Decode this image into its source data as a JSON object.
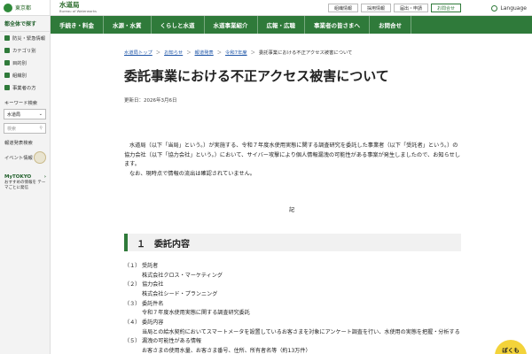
{
  "sidebar": {
    "logo_text": "東京都",
    "section_title": "都全体で探す",
    "items": [
      {
        "label": "防災・緊急情報"
      },
      {
        "label": "カテゴリ別"
      },
      {
        "label": "目的別"
      },
      {
        "label": "組織別"
      },
      {
        "label": "事業者の方"
      }
    ],
    "keyword_label": "キーワード検索",
    "select_value": "水道局",
    "search_placeholder": "検索",
    "press_label": "報道発表検索",
    "event_label": "イベント情報",
    "mytokyo_title": "MyTOKYO",
    "mytokyo_sub": "おすすめの情報を テーマごとに発信"
  },
  "header": {
    "title": "水道局",
    "subtitle": "Bureau of Waterworks",
    "links": [
      "組織情報",
      "採用情報",
      "届出・申請",
      "お問合せ"
    ],
    "language": "Language"
  },
  "nav": [
    "手続き・料金",
    "水源・水質",
    "くらしと水道",
    "水道事業紹介",
    "広報・広聴",
    "事業者の皆さまへ",
    "お問合せ"
  ],
  "breadcrumb": [
    "水道局トップ",
    "お知らせ",
    "報道発表",
    "令和7年度",
    "委託事業における不正アクセス被害について"
  ],
  "page": {
    "title": "委託事業における不正アクセス被害について",
    "updated": "更新日：2026年3月6日",
    "para1": "水道局（以下「当局」という。）が実施する、令和７年度水使用実態に関する調査研究を委託した事業者（以下「受託者」という。）の協力会社（以下「協力会社」という。）において、サイバー攻撃により個人情報漏洩の可能性がある事案が発生しましたので、お知らせします。",
    "para2": "なお、現時点で情報の流出は確認されていません。",
    "ki": "記",
    "section1": "１　委託内容",
    "list": {
      "i1_num": "（１）",
      "i1_label": "受託者",
      "i1_value": "株式会社クロス・マーケティング",
      "i2_num": "（２）",
      "i2_label": "協力会社",
      "i2_value": "株式会社シード・プランニング",
      "i3_num": "（３）",
      "i3_label": "委託件名",
      "i3_value": "令和７年度水使用実態に関する調査研究委託",
      "i4_num": "（４）",
      "i4_label": "委託内容",
      "i4_value": "当局との給水契約においてスマートメータを設置しているお客さまを対象にアンケート調査を行い、水使用の実態を把握・分析する",
      "i5_num": "（５）",
      "i5_label": "漏洩の可能性がある情報",
      "i5_value": "お客さまの使用水量、お客さま番号、住所、所有者名等（約13万件）"
    }
  },
  "badge": "ぼくも",
  "colors": {
    "primary_green": "#2f7a3a"
  }
}
